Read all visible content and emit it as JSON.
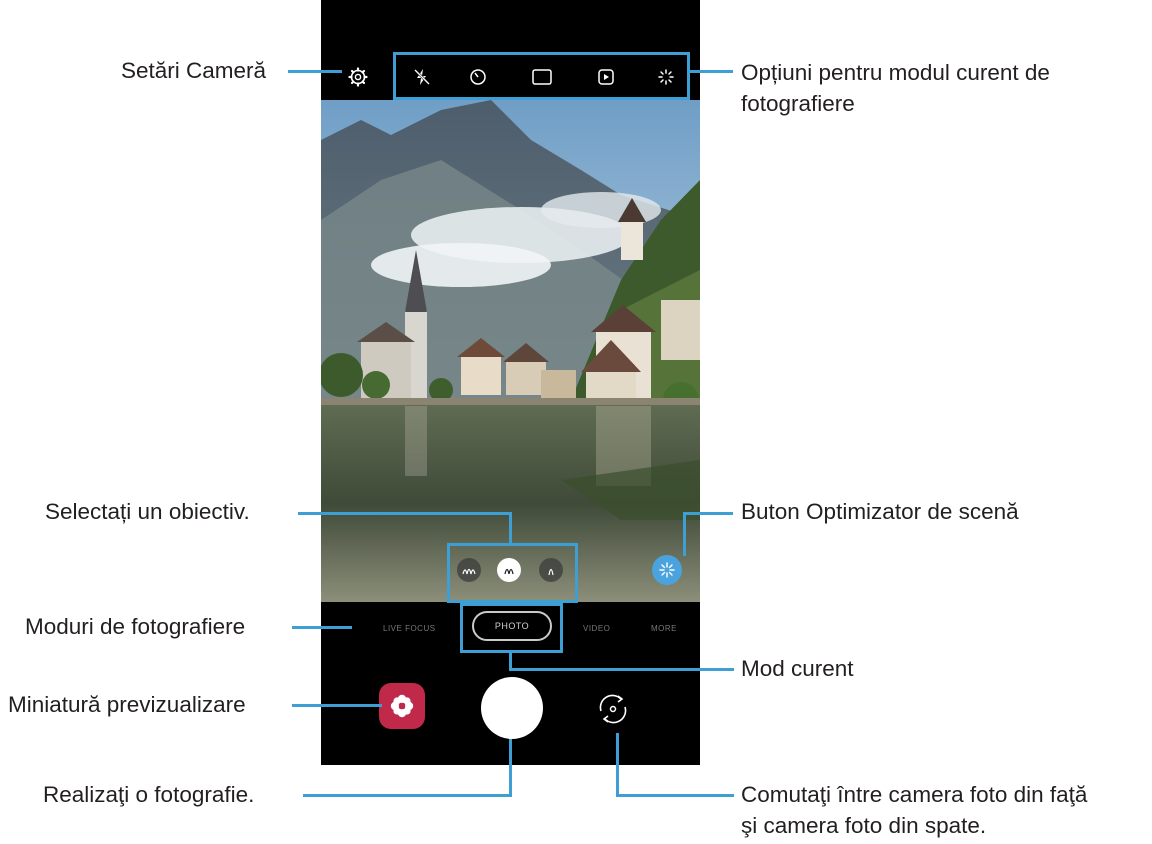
{
  "labels": {
    "settings": "Setări Cameră",
    "options_line1": "Opțiuni pentru modul curent de",
    "options_line2": "fotografiere",
    "select_lens": "Selectați un obiectiv.",
    "scene_optimizer": "Buton Optimizator de scenă",
    "shooting_modes": "Moduri de fotografiere",
    "current_mode": "Mod curent",
    "preview_thumbnail": "Miniatură previzualizare",
    "take_picture": "Realizaţi o fotografie.",
    "switch_line1": "Comutaţi între camera foto din faţă",
    "switch_line2": "şi camera foto din spate."
  },
  "camera": {
    "modes": [
      "",
      "LIVE FOCUS",
      "PHOTO",
      "VIDEO",
      "MORE"
    ],
    "current_mode": "PHOTO",
    "top_icons": [
      "flash-off-icon",
      "timer-icon",
      "aspect-ratio-icon",
      "motion-photo-icon",
      "filter-icon"
    ],
    "lens_icons": [
      "ultra-wide-lens-icon",
      "wide-lens-icon",
      "telephoto-lens-icon"
    ]
  },
  "colors": {
    "accent": "#3d9fd3",
    "thumbnail": "#c0294a",
    "scene_optimizer": "#4aa3dc"
  }
}
